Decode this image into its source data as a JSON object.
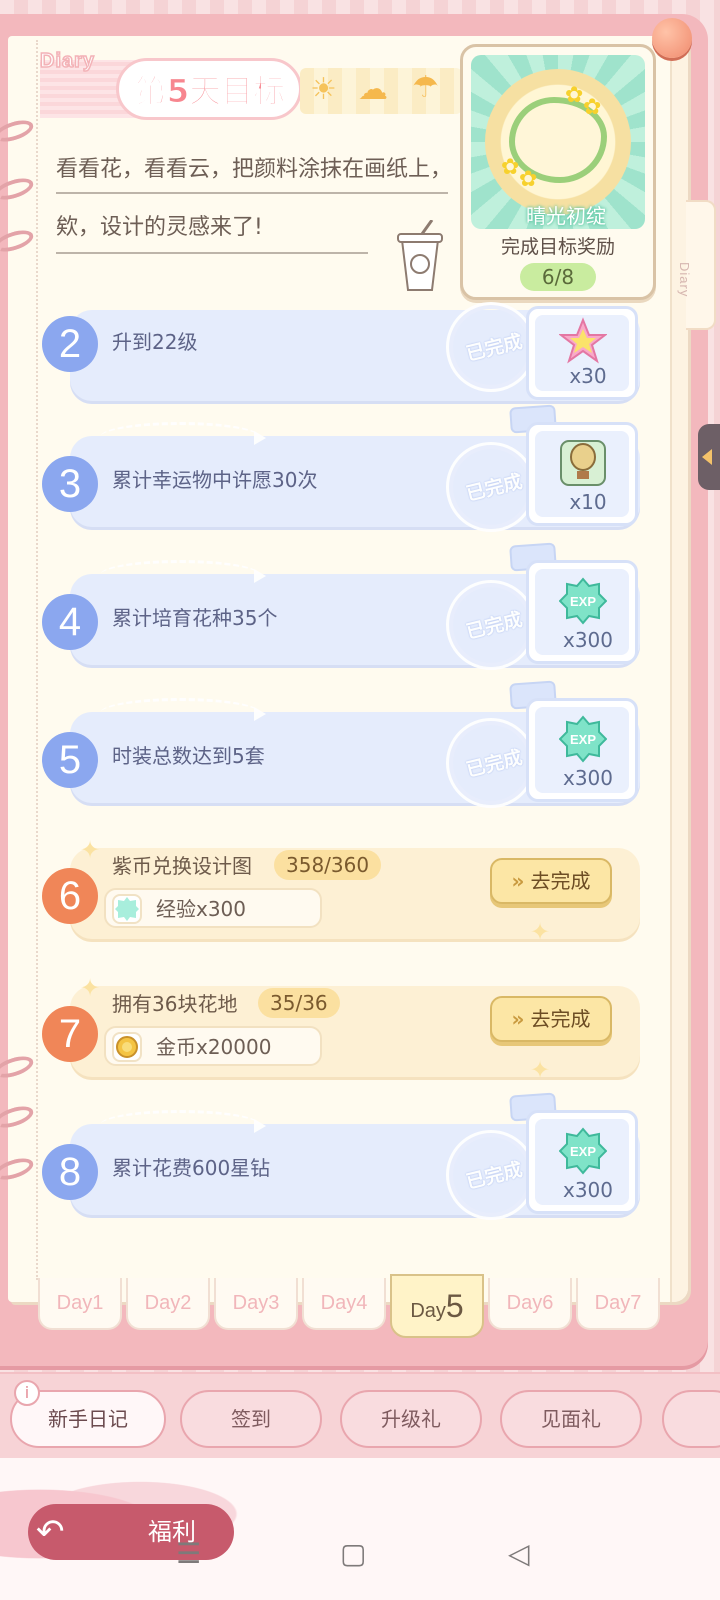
{
  "header": {
    "diary_label": "Diary",
    "title": "第5天目标",
    "intro_line1": "看看花，看看云，把颜料涂抹在画纸上，",
    "intro_line2": "欸，设计的灵感来了!"
  },
  "reward_card": {
    "item_name": "晴光初绽",
    "label": "完成目标奖励",
    "count": "6/8"
  },
  "side_tab": {
    "label": "Diary"
  },
  "tasks_done": [
    {
      "num": "2",
      "label": "升到22级",
      "stamp": "已完成",
      "reward_icon": "star-icon",
      "qty": "x30"
    },
    {
      "num": "3",
      "label": "累计幸运物中许愿30次",
      "stamp": "已完成",
      "reward_icon": "hot-air-balloon-icon",
      "qty": "x10"
    },
    {
      "num": "4",
      "label": "累计培育花种35个",
      "stamp": "已完成",
      "reward_icon": "exp-badge-icon",
      "qty": "x300"
    },
    {
      "num": "5",
      "label": "时装总数达到5套",
      "stamp": "已完成",
      "reward_icon": "exp-badge-icon",
      "qty": "x300"
    },
    {
      "num": "8",
      "label": "累计花费600星钻",
      "stamp": "已完成",
      "reward_icon": "exp-badge-icon",
      "qty": "x300"
    }
  ],
  "tasks_todo": [
    {
      "num": "6",
      "label": "紫币兑换设计图",
      "progress": "358/360",
      "reward_icon": "exp-badge-icon",
      "reward_text": "经验x300",
      "button": "去完成"
    },
    {
      "num": "7",
      "label": "拥有36块花地",
      "progress": "35/36",
      "reward_icon": "gold-coin-icon",
      "reward_text": "金币x20000",
      "button": "去完成"
    }
  ],
  "day_tabs": {
    "day1": "Day1",
    "day2": "Day2",
    "day3": "Day3",
    "day4": "Day4",
    "day5_prefix": "Day",
    "day5_num": "5",
    "day6": "Day6",
    "day7": "Day7"
  },
  "categories": {
    "c1": "新手日记",
    "c2": "签到",
    "c3": "升级礼",
    "c4": "见面礼"
  },
  "bottom": {
    "fuli": "福利"
  },
  "colors": {
    "done_band": "#e5ecfc",
    "todo_band": "#fdf0d4",
    "done_num": "#8ba7ef",
    "todo_num": "#f08658",
    "title": "#f7868f"
  }
}
